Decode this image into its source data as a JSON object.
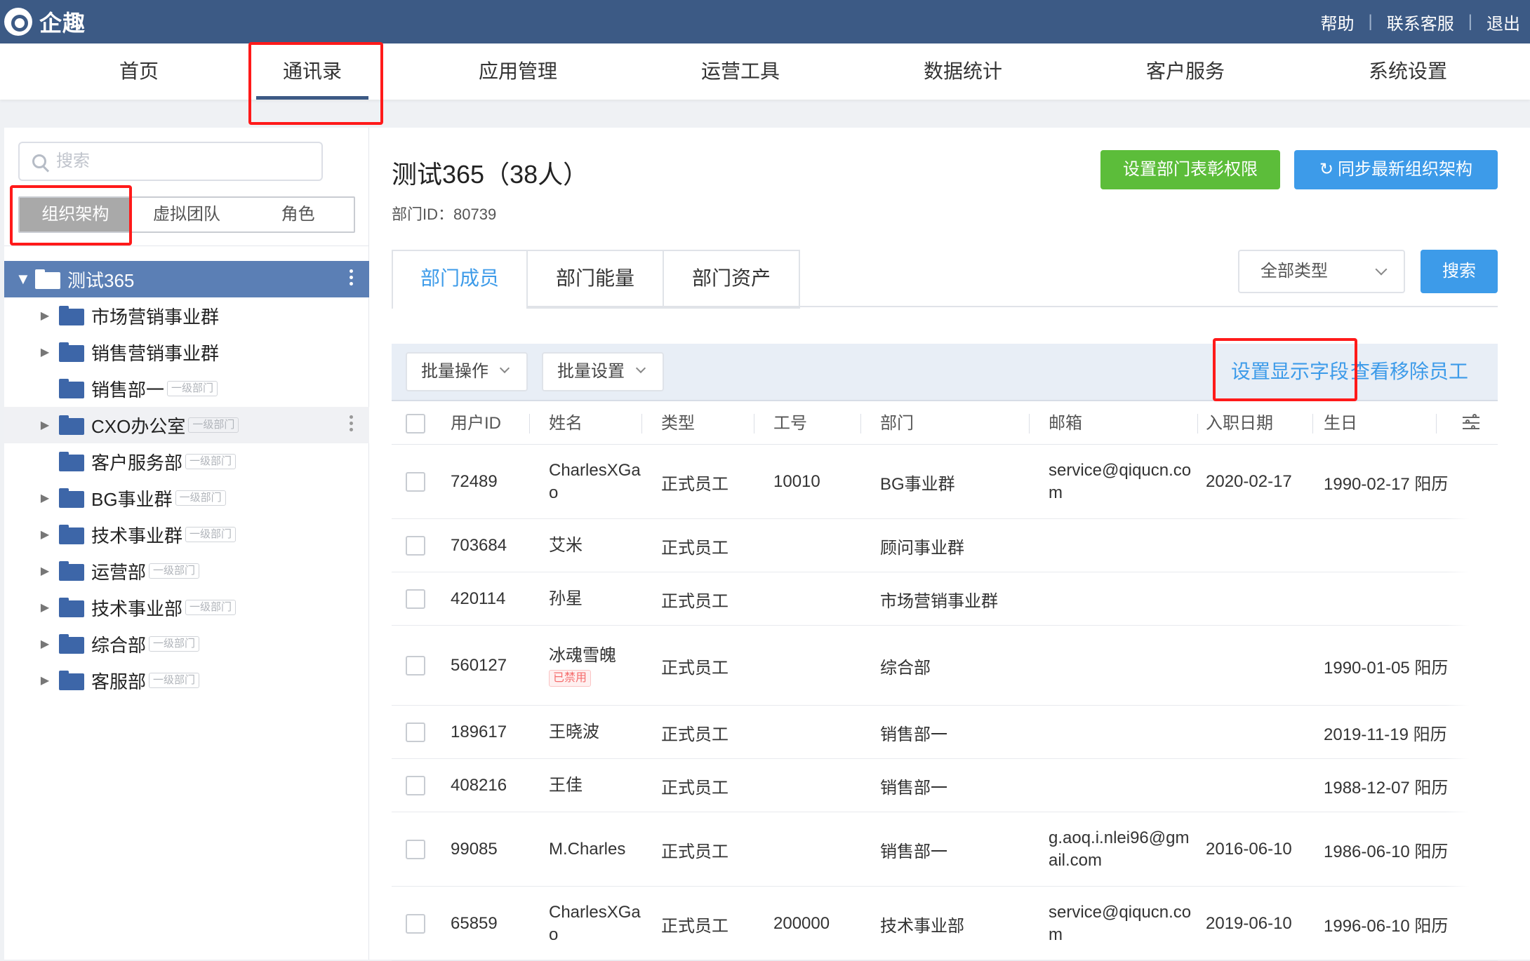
{
  "app": {
    "name": "企趣"
  },
  "top_links": [
    "帮助",
    "联系客服",
    "退出"
  ],
  "nav": [
    "首页",
    "通讯录",
    "应用管理",
    "运营工具",
    "数据统计",
    "客户服务",
    "系统设置"
  ],
  "sidebar": {
    "search_placeholder": "搜索",
    "segments": [
      "组织架构",
      "虚拟团队",
      "角色"
    ],
    "root": "测试365",
    "badge": "一级部门",
    "items": [
      {
        "label": "市场营销事业群",
        "arrow": true,
        "badge": false
      },
      {
        "label": "销售营销事业群",
        "arrow": true,
        "badge": false
      },
      {
        "label": "销售部一",
        "arrow": false,
        "badge": true
      },
      {
        "label": "CXO办公室",
        "arrow": true,
        "badge": true
      },
      {
        "label": "客户服务部",
        "arrow": false,
        "badge": true
      },
      {
        "label": "BG事业群",
        "arrow": true,
        "badge": true
      },
      {
        "label": "技术事业群",
        "arrow": true,
        "badge": true
      },
      {
        "label": "运营部",
        "arrow": true,
        "badge": true
      },
      {
        "label": "技术事业部",
        "arrow": true,
        "badge": true
      },
      {
        "label": "综合部",
        "arrow": true,
        "badge": true
      },
      {
        "label": "客服部",
        "arrow": true,
        "badge": true
      }
    ]
  },
  "main": {
    "title": "测试365（38人）",
    "dept_id": "部门ID：80739",
    "btn_permission": "设置部门表彰权限",
    "btn_sync": "同步最新组织架构",
    "tabs": [
      "部门成员",
      "部门能量",
      "部门资产"
    ],
    "type_select": "全部类型",
    "search_btn": "搜索",
    "batch_op": "批量操作",
    "batch_set": "批量设置",
    "link_fields": "设置显示字段",
    "link_removed": "查看移除员工",
    "disabled_label": "已禁用",
    "columns": [
      "用户ID",
      "姓名",
      "类型",
      "工号",
      "部门",
      "邮箱",
      "入职日期",
      "生日"
    ],
    "rows": [
      {
        "id": "72489",
        "name": "CharlesXGao",
        "type": "正式员工",
        "no": "10010",
        "dept": "BG事业群",
        "email": "service@qiqucn.com",
        "join": "2020-02-17",
        "birth": "1990-02-17 阳历",
        "disabled": false
      },
      {
        "id": "703684",
        "name": "艾米",
        "type": "正式员工",
        "no": "",
        "dept": "顾问事业群",
        "email": "",
        "join": "",
        "birth": "",
        "disabled": false
      },
      {
        "id": "420114",
        "name": "孙星",
        "type": "正式员工",
        "no": "",
        "dept": "市场营销事业群",
        "email": "",
        "join": "",
        "birth": "",
        "disabled": false
      },
      {
        "id": "560127",
        "name": "冰魂雪魄",
        "type": "正式员工",
        "no": "",
        "dept": "综合部",
        "email": "",
        "join": "",
        "birth": "1990-01-05 阳历",
        "disabled": true
      },
      {
        "id": "189617",
        "name": "王晓波",
        "type": "正式员工",
        "no": "",
        "dept": "销售部一",
        "email": "",
        "join": "",
        "birth": "2019-11-19 阳历",
        "disabled": false
      },
      {
        "id": "408216",
        "name": "王佳",
        "type": "正式员工",
        "no": "",
        "dept": "销售部一",
        "email": "",
        "join": "",
        "birth": "1988-12-07 阳历",
        "disabled": false
      },
      {
        "id": "99085",
        "name": "M.Charles",
        "type": "正式员工",
        "no": "",
        "dept": "销售部一",
        "email": "g.aoq.i.nlei96@gmail.com",
        "join": "2016-06-10",
        "birth": "1986-06-10 阳历",
        "disabled": false
      },
      {
        "id": "65859",
        "name": "CharlesXGao",
        "type": "正式员工",
        "no": "200000",
        "dept": "技术事业部",
        "email": "service@qiqucn.com",
        "join": "2019-06-10",
        "birth": "1996-06-10 阳历",
        "disabled": false
      }
    ]
  }
}
